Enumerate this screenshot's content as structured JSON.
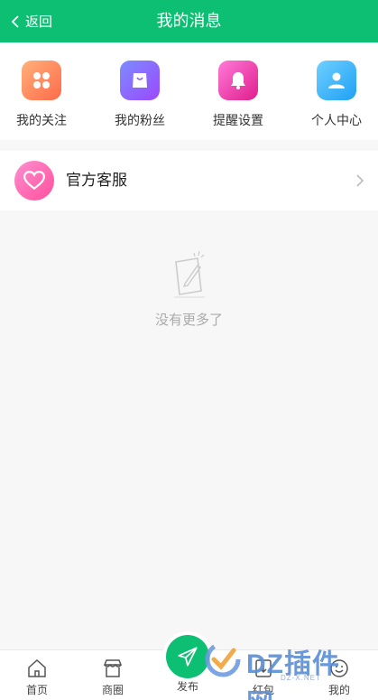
{
  "header": {
    "back_label": "返回",
    "title": "我的消息",
    "bg_color": "#0cbf72"
  },
  "quick_links": [
    {
      "label": "我的关注",
      "icon": "grid-icon"
    },
    {
      "label": "我的粉丝",
      "icon": "bag-icon"
    },
    {
      "label": "提醒设置",
      "icon": "bell-icon"
    },
    {
      "label": "个人中心",
      "icon": "user-icon"
    }
  ],
  "service": {
    "label": "官方客服",
    "icon": "heart-icon"
  },
  "empty_state": {
    "text": "没有更多了",
    "icon": "note-pencil-icon"
  },
  "tabbar": [
    {
      "label": "首页",
      "icon": "home-icon"
    },
    {
      "label": "商圈",
      "icon": "store-icon"
    },
    {
      "label": "发布",
      "icon": "send-icon"
    },
    {
      "label": "红包",
      "icon": "redpacket-icon"
    },
    {
      "label": "我的",
      "icon": "smile-icon"
    }
  ],
  "watermark": {
    "text": "DZ插件网",
    "sub": "DZ-X.NET"
  }
}
